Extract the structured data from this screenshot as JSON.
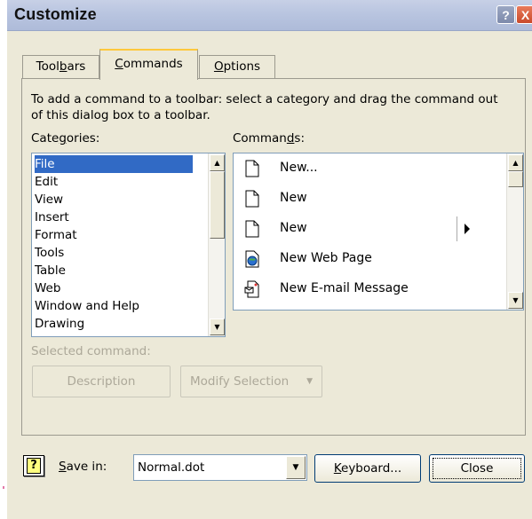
{
  "window": {
    "title": "Customize"
  },
  "titlebar": {
    "help_glyph": "?",
    "close_glyph": "X"
  },
  "tabs": [
    {
      "label_pre": "Tool",
      "label_key": "b",
      "label_post": "ars"
    },
    {
      "label_pre": "",
      "label_key": "C",
      "label_post": "ommands"
    },
    {
      "label_pre": "",
      "label_key": "O",
      "label_post": "ptions"
    }
  ],
  "instructions": "To add a command to a toolbar: select a category and drag the command out of this dialog box to a toolbar.",
  "categories": {
    "label_pre": "Cate",
    "label_key": "g",
    "label_post": "ories:",
    "items": [
      "File",
      "Edit",
      "View",
      "Insert",
      "Format",
      "Tools",
      "Table",
      "Web",
      "Window and Help",
      "Drawing"
    ],
    "selected": "File"
  },
  "commands": {
    "label_pre": "Comman",
    "label_key": "d",
    "label_post": "s:",
    "items": [
      {
        "label": "New...",
        "icon": "blank-page-icon"
      },
      {
        "label": "New",
        "icon": "blank-page-icon"
      },
      {
        "label": "New",
        "icon": "blank-page-icon",
        "submenu": true
      },
      {
        "label": "New Web Page",
        "icon": "web-page-icon"
      },
      {
        "label": "New E-mail Message",
        "icon": "email-message-icon"
      }
    ]
  },
  "selected_command_label": "Selected command:",
  "buttons": {
    "description": "Description",
    "modify_selection": "Modify Selection",
    "keyboard_pre": "",
    "keyboard_key": "K",
    "keyboard_post": "eyboard...",
    "close": "Close"
  },
  "save_in": {
    "label_pre": "",
    "label_key": "S",
    "label_post": "ave in:",
    "value": "Normal.dot"
  },
  "help_icon_glyph": "?"
}
